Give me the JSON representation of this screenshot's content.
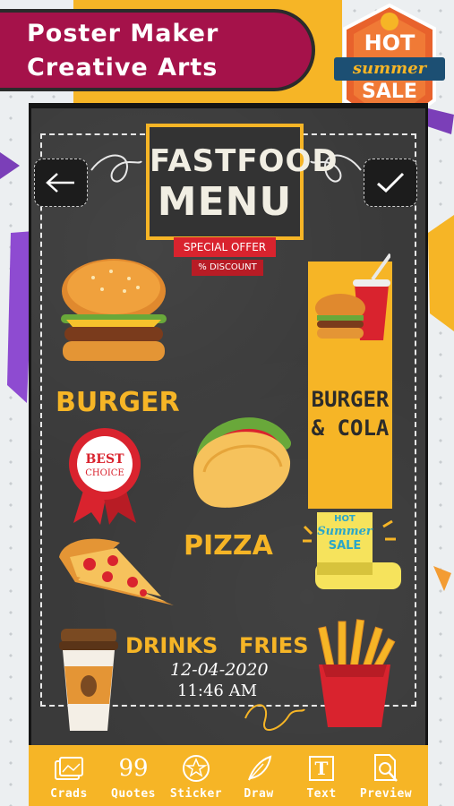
{
  "banner": {
    "line1": "Poster Maker",
    "line2": "Creative Arts"
  },
  "badge": {
    "hot": "HOT",
    "summer": "summer",
    "sale": "SALE"
  },
  "poster": {
    "title_line1": "FASTFOOD",
    "title_line2": "MENU",
    "special_offer": "SPECIAL OFFER",
    "discount": "% DISCOUNT",
    "burger_label": "BURGER",
    "best_choice_line1": "BEST",
    "best_choice_line2": "CHOICE",
    "panel_line1": "BURGER",
    "panel_line2": "& COLA",
    "pizza_label": "PIZZA",
    "sticker_hot": "HOT",
    "sticker_summer": "Summer",
    "sticker_sale": "SALE",
    "drinks_label": "DRINKS",
    "fries_label": "FRIES",
    "date": "12-04-2020",
    "time": "11:46 AM"
  },
  "toolbar": {
    "items": [
      {
        "label": "Crads",
        "icon": "cards-icon"
      },
      {
        "label": "Quotes",
        "icon": "quotes-icon",
        "glyph": "99"
      },
      {
        "label": "Sticker",
        "icon": "sticker-icon"
      },
      {
        "label": "Draw",
        "icon": "feather-icon"
      },
      {
        "label": "Text",
        "icon": "text-icon",
        "glyph": "T"
      },
      {
        "label": "Preview",
        "icon": "preview-icon"
      }
    ]
  },
  "colors": {
    "brand_magenta": "#a5124a",
    "accent_yellow": "#f6b526",
    "chalkboard": "#3a3a3a",
    "ribbon_red": "#d9232e"
  }
}
